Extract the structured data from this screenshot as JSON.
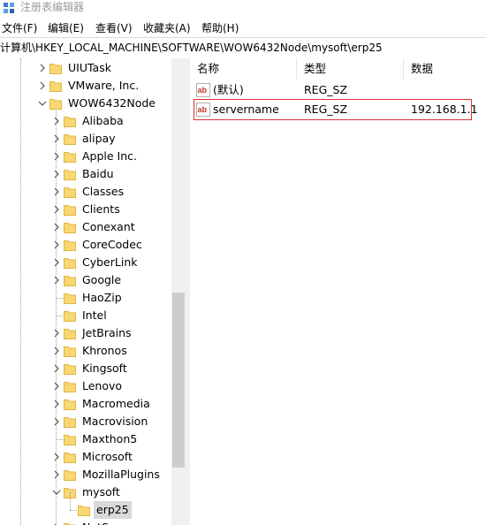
{
  "window": {
    "title": "注册表编辑器"
  },
  "menu": [
    "文件(F)",
    "编辑(E)",
    "查看(V)",
    "收藏夹(A)",
    "帮助(H)"
  ],
  "address": {
    "path": "计算机\\HKEY_LOCAL_MACHINE\\SOFTWARE\\WOW6432Node\\mysoft\\erp25"
  },
  "tree": {
    "items": [
      {
        "label": "UIUTask",
        "level": 1,
        "expander": "collapsed"
      },
      {
        "label": "VMware, Inc.",
        "level": 1,
        "expander": "collapsed"
      },
      {
        "label": "WOW6432Node",
        "level": 1,
        "expander": "expanded"
      },
      {
        "label": "Alibaba",
        "level": 2,
        "expander": "collapsed"
      },
      {
        "label": "alipay",
        "level": 2,
        "expander": "collapsed"
      },
      {
        "label": "Apple Inc.",
        "level": 2,
        "expander": "collapsed"
      },
      {
        "label": "Baidu",
        "level": 2,
        "expander": "collapsed"
      },
      {
        "label": "Classes",
        "level": 2,
        "expander": "collapsed"
      },
      {
        "label": "Clients",
        "level": 2,
        "expander": "collapsed"
      },
      {
        "label": "Conexant",
        "level": 2,
        "expander": "collapsed"
      },
      {
        "label": "CoreCodec",
        "level": 2,
        "expander": "collapsed"
      },
      {
        "label": "CyberLink",
        "level": 2,
        "expander": "collapsed"
      },
      {
        "label": "Google",
        "level": 2,
        "expander": "collapsed"
      },
      {
        "label": "HaoZip",
        "level": 2,
        "expander": "none"
      },
      {
        "label": "Intel",
        "level": 2,
        "expander": "none"
      },
      {
        "label": "JetBrains",
        "level": 2,
        "expander": "collapsed"
      },
      {
        "label": "Khronos",
        "level": 2,
        "expander": "collapsed"
      },
      {
        "label": "Kingsoft",
        "level": 2,
        "expander": "collapsed"
      },
      {
        "label": "Lenovo",
        "level": 2,
        "expander": "collapsed"
      },
      {
        "label": "Macromedia",
        "level": 2,
        "expander": "collapsed"
      },
      {
        "label": "Macrovision",
        "level": 2,
        "expander": "collapsed"
      },
      {
        "label": "Maxthon5",
        "level": 2,
        "expander": "none"
      },
      {
        "label": "Microsoft",
        "level": 2,
        "expander": "collapsed"
      },
      {
        "label": "MozillaPlugins",
        "level": 2,
        "expander": "collapsed"
      },
      {
        "label": "mysoft",
        "level": 2,
        "expander": "expanded"
      },
      {
        "label": "erp25",
        "level": 3,
        "expander": "none",
        "selected": true
      },
      {
        "label": "NetSarang",
        "level": 2,
        "expander": "collapsed"
      }
    ]
  },
  "list": {
    "columns": [
      "名称",
      "类型",
      "数据"
    ],
    "rows": [
      {
        "name": "(默认)",
        "type": "REG_SZ",
        "data": ""
      },
      {
        "name": "servername",
        "type": "REG_SZ",
        "data": "192.168.1.1"
      }
    ]
  },
  "colors": {
    "folder": "#f8d775",
    "folder_dark": "#e2b53f",
    "highlight_border": "#e03030",
    "selection": "#d9d9d9"
  }
}
